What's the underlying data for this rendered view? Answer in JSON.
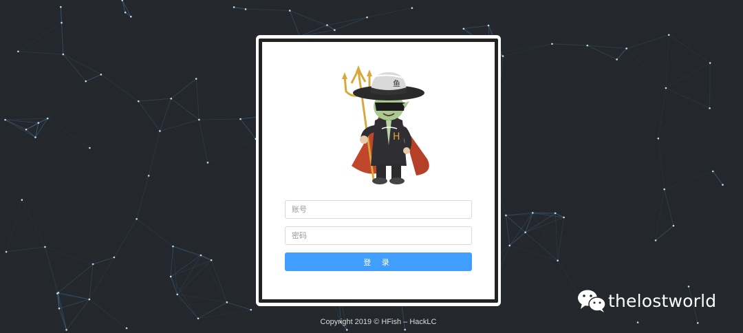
{
  "login": {
    "account_placeholder": "账号",
    "password_placeholder": "密码",
    "submit_label": "登 录"
  },
  "footer": {
    "copyright": "Copyright 2019 © HFish – HackLC"
  },
  "watermark": {
    "icon": "wechat-icon",
    "text": "thelostworld"
  },
  "colors": {
    "background": "#24272b",
    "network_lines": "#3d6d97",
    "button": "#409eff",
    "card": "#ffffff",
    "card_border": "#222222"
  },
  "mascot": {
    "icon": "devil-mascot-icon"
  }
}
